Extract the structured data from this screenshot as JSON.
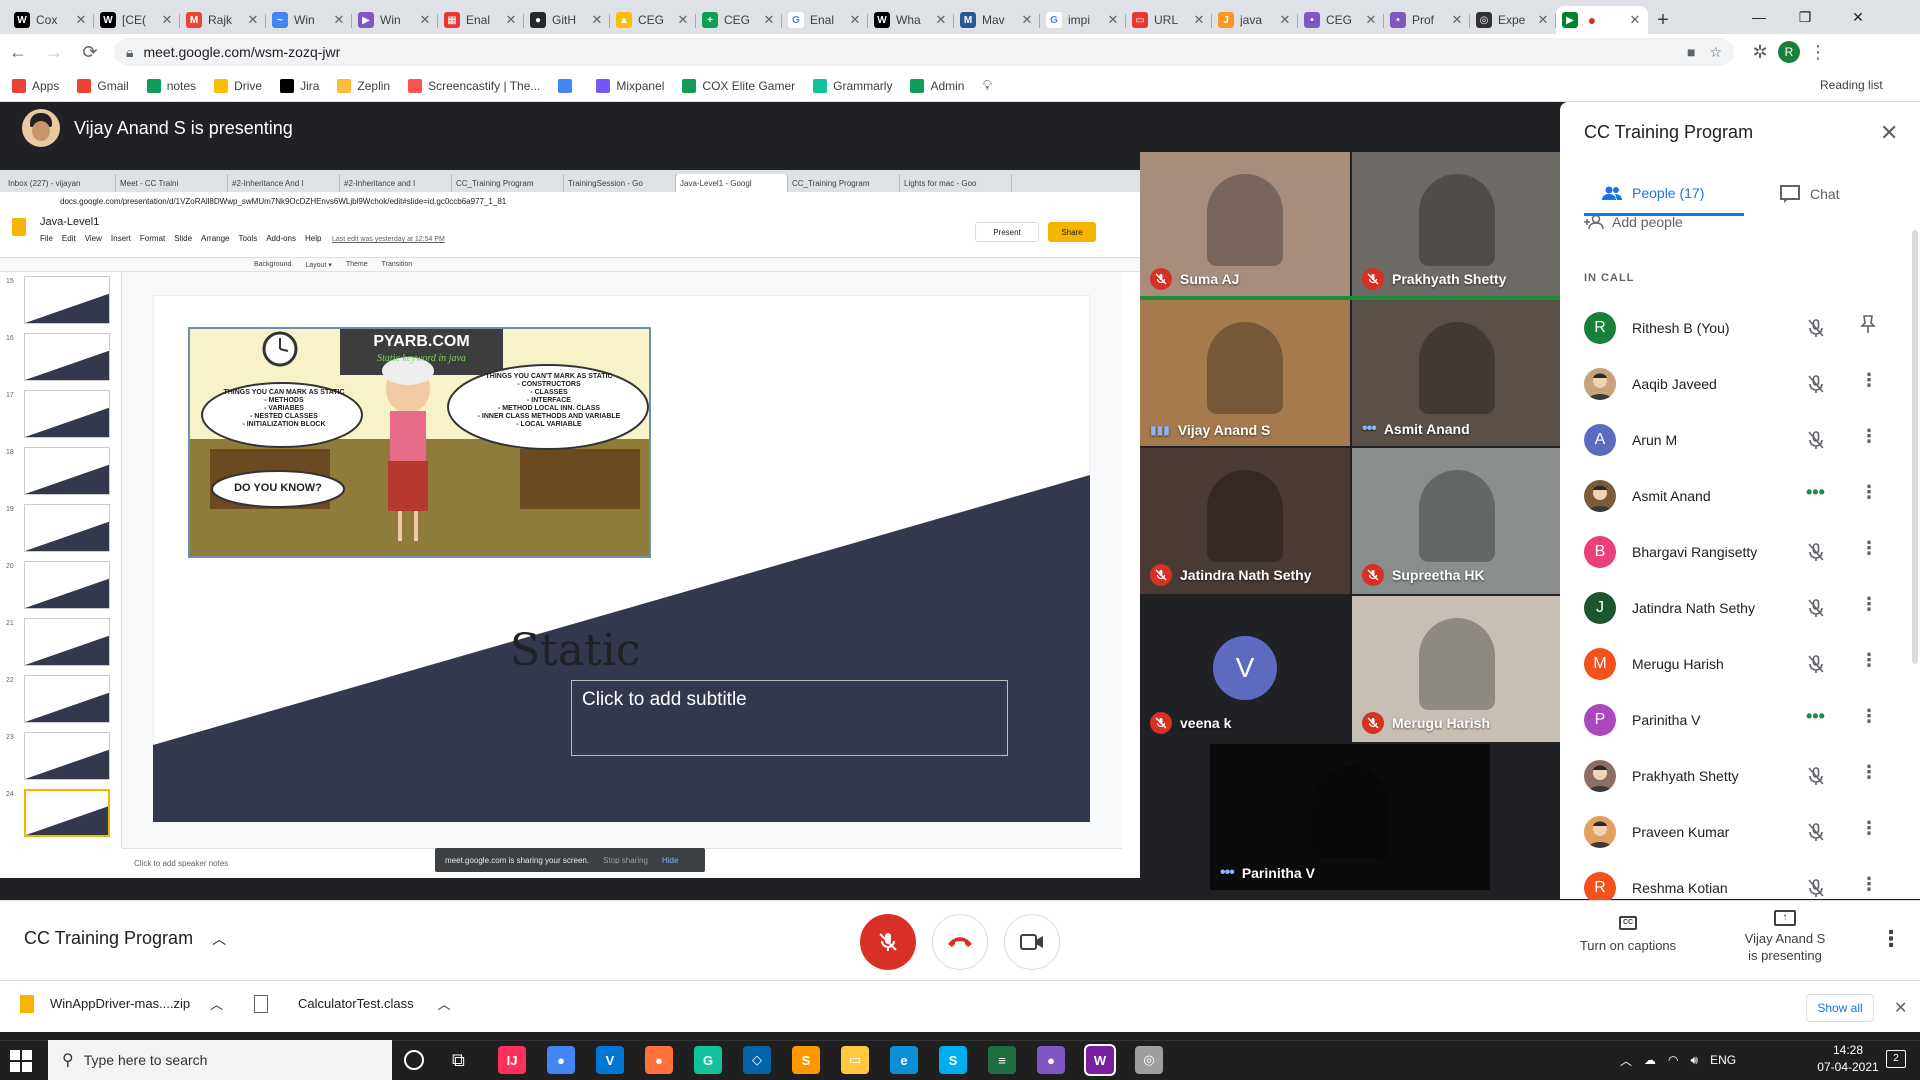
{
  "browser": {
    "tabs": [
      {
        "label": "Cox",
        "color": "#000000",
        "glyph": "W"
      },
      {
        "label": "[CE(",
        "color": "#000000",
        "glyph": "W"
      },
      {
        "label": "Rajk",
        "color": "#ea4335",
        "glyph": "M"
      },
      {
        "label": "Win",
        "color": "#4285f4",
        "glyph": "~"
      },
      {
        "label": "Win",
        "color": "#7e57c2",
        "glyph": "▶"
      },
      {
        "label": "Enal",
        "color": "#e53935",
        "glyph": "▦"
      },
      {
        "label": "GitH",
        "color": "#24292e",
        "glyph": "●"
      },
      {
        "label": "CEG",
        "color": "#fbbc04",
        "glyph": "▲"
      },
      {
        "label": "CEG",
        "color": "#0f9d58",
        "glyph": "+"
      },
      {
        "label": "Enal",
        "color": "#ffffff",
        "glyph": "G"
      },
      {
        "label": "Wha",
        "color": "#000000",
        "glyph": "W"
      },
      {
        "label": "Mav",
        "color": "#2b5797",
        "glyph": "M"
      },
      {
        "label": "impi",
        "color": "#ffffff",
        "glyph": "G"
      },
      {
        "label": "URL",
        "color": "#e53935",
        "glyph": "▭"
      },
      {
        "label": "java",
        "color": "#f89820",
        "glyph": "J"
      },
      {
        "label": "CEG",
        "color": "#7e57c2",
        "glyph": "•"
      },
      {
        "label": "Prof",
        "color": "#7e57c2",
        "glyph": "•"
      },
      {
        "label": "Expe",
        "color": "#333333",
        "glyph": "◎"
      }
    ],
    "url": "meet.google.com/wsm-zozq-jwr",
    "bookmarks": [
      {
        "label": "Apps",
        "color": "#ea4335"
      },
      {
        "label": "Gmail",
        "color": "#ea4335"
      },
      {
        "label": "notes",
        "color": "#0f9d58"
      },
      {
        "label": "Drive",
        "color": "#fbbc04"
      },
      {
        "label": "Jira",
        "color": "#000000"
      },
      {
        "label": "Zeplin",
        "color": "#fdbd39"
      },
      {
        "label": "Screencastify | The...",
        "color": "#ff5252"
      },
      {
        "label": "",
        "color": "#4285f4"
      },
      {
        "label": "Mixpanel",
        "color": "#7856ff"
      },
      {
        "label": "COX Elite Gamer",
        "color": "#0f9d58"
      },
      {
        "label": "Grammarly",
        "color": "#15c39a"
      },
      {
        "label": "Admin",
        "color": "#0f9d58"
      }
    ],
    "reading_list": "Reading list",
    "profile_initial": "R"
  },
  "meet": {
    "presenting_banner": "Vijay Anand S is presenting",
    "shared": {
      "inner_tabs": [
        "Inbox (227) - vijayan",
        "Meet - CC Traini",
        "#2-Inheritance And I",
        "#2-Inheritance and I",
        "CC_Training Program",
        "TrainingSession - Go",
        "Java-Level1 - Googl",
        "CC_Training Program",
        "Lights for mac - Goo"
      ],
      "inner_url": "docs.google.com/presentation/d/1VZoRAll8DWwp_swMUm7Nk9OcDZHEnvs6WLjbl9Wchok/edit#slide=id.gc0ccb6a977_1_81",
      "doc_title": "Java-Level1",
      "menu": [
        "File",
        "Edit",
        "View",
        "Insert",
        "Format",
        "Slide",
        "Arrange",
        "Tools",
        "Add-ons",
        "Help"
      ],
      "last_edit": "Last edit was yesterday at 12:54 PM",
      "present_label": "Present",
      "share_label": "Share",
      "toolbar_items": [
        "Background",
        "Layout ▾",
        "Theme",
        "Transition"
      ],
      "thumb_numbers": [
        "15",
        "16",
        "17",
        "18",
        "19",
        "20",
        "21",
        "22",
        "23",
        "24"
      ],
      "slide_title": "Static",
      "slide_subtitle": "Click to add subtitle",
      "comic": {
        "site": "PYARB.COM",
        "tagline": "Static keyword in java",
        "left_bubble": [
          "THINGS YOU CAN MARK AS STATIC",
          "- METHODS",
          "- VARIABES",
          "- NESTED CLASSES",
          "- INITIALIZATION BLOCK"
        ],
        "right_bubble": [
          "THINGS YOU CAN'T MARK AS STATIC",
          "- CONSTRUCTORS",
          "- CLASSES",
          "- INTERFACE",
          "- METHOD LOCAL INN. CLASS",
          "- INNER CLASS METHODS AND VARIABLE",
          "- LOCAL VARIABLE"
        ],
        "bottom_bubble": "DO YOU KNOW?"
      },
      "speaker_notes": "Click to add speaker notes",
      "share_notice": "meet.google.com is sharing your screen.",
      "stop_sharing": "Stop sharing",
      "hide": "Hide"
    },
    "tiles": [
      {
        "name": "Suma AJ",
        "status": "muted",
        "bg": "#a88d7c"
      },
      {
        "name": "Prakhyath Shetty",
        "status": "muted",
        "bg": "#6e6a66"
      },
      {
        "name": "Vijay Anand S",
        "status": "speaking",
        "bg": "#a57a4e"
      },
      {
        "name": "Asmit Anand",
        "status": "talking",
        "bg": "#5a5048"
      },
      {
        "name": "Jatindra Nath Sethy",
        "status": "muted",
        "bg": "#4a3a34"
      },
      {
        "name": "Supreetha HK",
        "status": "muted",
        "bg": "#8a8f8c"
      },
      {
        "name": "veena k",
        "status": "muted",
        "bg": "#202124",
        "avatar": "V",
        "avatar_color": "#5c6bc0"
      },
      {
        "name": "Merugu Harish",
        "status": "muted",
        "bg": "#c7bfb3"
      },
      {
        "name": "Parinitha V",
        "status": "talking",
        "bg": "#0b0b0b"
      }
    ],
    "panel": {
      "title": "CC Training Program",
      "tab_people": "People (17)",
      "tab_chat": "Chat",
      "add_people": "Add people",
      "in_call": "IN CALL",
      "people": [
        {
          "name": "Rithesh B (You)",
          "initial": "R",
          "color": "#188038",
          "status": "muted",
          "action": "pin"
        },
        {
          "name": "Aaqib Javeed",
          "initial": "",
          "color": "#c8a27a",
          "status": "muted",
          "action": "more"
        },
        {
          "name": "Arun M",
          "initial": "A",
          "color": "#5c6bc0",
          "status": "muted",
          "action": "more"
        },
        {
          "name": "Asmit Anand",
          "initial": "",
          "color": "#7a5b3a",
          "status": "talking",
          "action": "more"
        },
        {
          "name": "Bhargavi Rangisetty",
          "initial": "B",
          "color": "#ec407a",
          "status": "muted",
          "action": "more"
        },
        {
          "name": "Jatindra Nath Sethy",
          "initial": "J",
          "color": "#1e5631",
          "status": "muted",
          "action": "more"
        },
        {
          "name": "Merugu Harish",
          "initial": "M",
          "color": "#f4511e",
          "status": "muted",
          "action": "more"
        },
        {
          "name": "Parinitha V",
          "initial": "P",
          "color": "#ab47bc",
          "status": "talking",
          "action": "more"
        },
        {
          "name": "Prakhyath Shetty",
          "initial": "",
          "color": "#8d6e63",
          "status": "muted",
          "action": "more"
        },
        {
          "name": "Praveen Kumar",
          "initial": "",
          "color": "#e0a060",
          "status": "muted",
          "action": "more"
        },
        {
          "name": "Reshma Kotian",
          "initial": "R",
          "color": "#f4511e",
          "status": "muted",
          "action": "more"
        }
      ]
    },
    "bottom": {
      "meeting_name": "CC Training Program",
      "captions": "Turn on captions",
      "presenting_line1": "Vijay Anand S",
      "presenting_line2": "is presenting"
    }
  },
  "downloads": {
    "items": [
      "WinAppDriver-mas....zip",
      "CalculatorTest.class"
    ],
    "show_all": "Show all"
  },
  "taskbar": {
    "search_placeholder": "Type here to search",
    "apps": [
      {
        "glyph": "IJ",
        "color": "#fe315d"
      },
      {
        "glyph": "●",
        "color": "#4285f4"
      },
      {
        "glyph": "V",
        "color": "#0078d4"
      },
      {
        "glyph": "●",
        "color": "#ff7139"
      },
      {
        "glyph": "G",
        "color": "#15c39a"
      },
      {
        "glyph": "◇",
        "color": "#0065a9"
      },
      {
        "glyph": "S",
        "color": "#ff9800"
      },
      {
        "glyph": "▭",
        "color": "#ffc83d"
      },
      {
        "glyph": "e",
        "color": "#0c8fd4"
      },
      {
        "glyph": "S",
        "color": "#00aff0"
      },
      {
        "glyph": "≡",
        "color": "#1d6f42"
      },
      {
        "glyph": "●",
        "color": "#7e57c2"
      },
      {
        "glyph": "W",
        "color": "#7b1fa2"
      },
      {
        "glyph": "◎",
        "color": "#9e9e9e"
      }
    ],
    "language": "ENG",
    "time": "14:28",
    "date": "07-04-2021",
    "notification_count": "2"
  }
}
